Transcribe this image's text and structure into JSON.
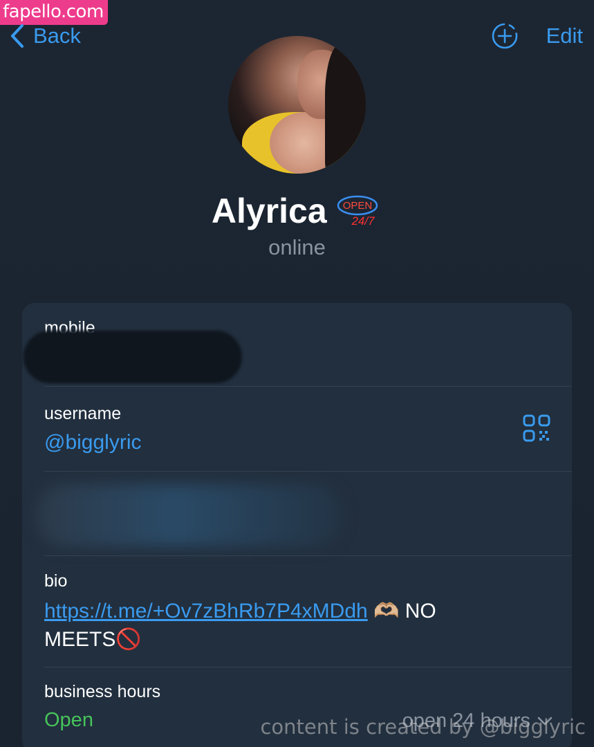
{
  "watermark_top": "fapello.com",
  "watermark_bottom": "content is created by @bigglyric",
  "nav": {
    "back_label": "Back",
    "edit_label": "Edit"
  },
  "profile": {
    "name": "Alyrica",
    "badge_line1": "OPEN",
    "badge_line2": "24/7",
    "status": "online"
  },
  "info": {
    "mobile_label": "mobile",
    "username_label": "username",
    "username_value": "@bigglyric",
    "bio_label": "bio",
    "bio_link": "https://t.me/+Ov7zBhRb7P4xMDdh",
    "bio_rest_1": " 🫶🏼 NO",
    "bio_rest_2": "MEETS🚫",
    "hours_label": "business hours",
    "hours_status": "Open",
    "hours_detail": "open 24 hours"
  },
  "colors": {
    "accent": "#3a9bef",
    "open_green": "#46c35a",
    "background": "#1c2633",
    "card": "#222f3e"
  }
}
